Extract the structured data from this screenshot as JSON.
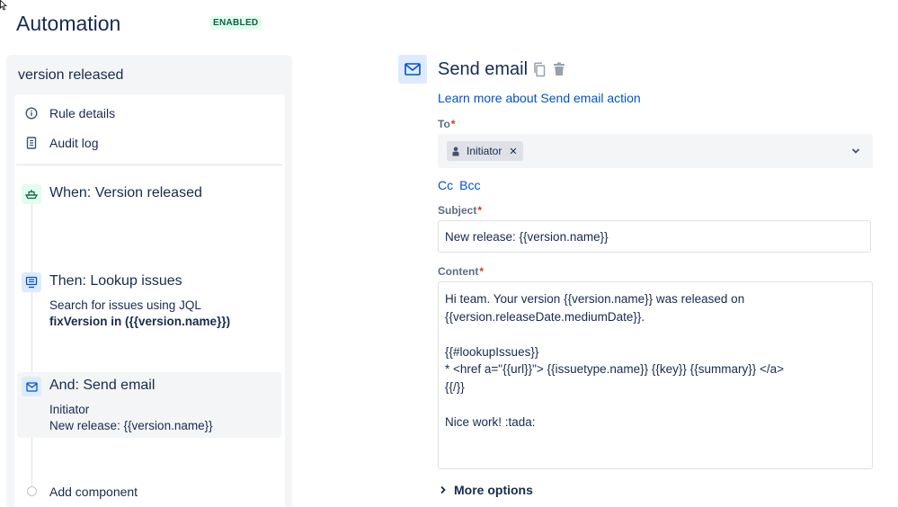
{
  "header": {
    "title": "Automation",
    "status_badge": "ENABLED"
  },
  "sidebar": {
    "rule_name": "version released",
    "menu": [
      {
        "label": "Rule details",
        "icon": "info-icon"
      },
      {
        "label": "Audit log",
        "icon": "document-icon"
      }
    ],
    "steps": [
      {
        "title": "When: Version released",
        "icon": "ship-icon",
        "color": "#e3fcef",
        "icon_color": "#006644"
      },
      {
        "title": "Then: Lookup issues",
        "icon": "lookup-icon",
        "color": "#deebff",
        "icon_color": "#0052cc",
        "desc": "Search for issues using JQL",
        "desc_bold": "fixVersion in ({{version.name}})"
      },
      {
        "title": "And: Send email",
        "icon": "mail-icon",
        "color": "#deebff",
        "icon_color": "#0052cc",
        "line1": "Initiator",
        "line2": "New release: {{version.name}}"
      }
    ],
    "add_component": "Add component"
  },
  "action": {
    "title": "Send email",
    "learn_more": "Learn more about Send email action",
    "to_label": "To",
    "to_chip": "Initiator",
    "cc": "Cc",
    "bcc": "Bcc",
    "subject_label": "Subject",
    "subject_value": "New release: {{version.name}}",
    "content_label": "Content",
    "content_value": "Hi team. Your version {{version.name}} was released on\n{{version.releaseDate.mediumDate}}.\n\n{{#lookupIssues}}\n* <href a=\"{{url}}\"> {{issuetype.name}} {{key}} {{summary}} </a>\n{{/}}\n\nNice work! :tada:",
    "more_options": "More options",
    "required_marker": "*"
  },
  "colors": {
    "link": "#0052cc",
    "required": "#de350b",
    "badge_bg": "#e3fcef",
    "badge_text": "#006644"
  }
}
